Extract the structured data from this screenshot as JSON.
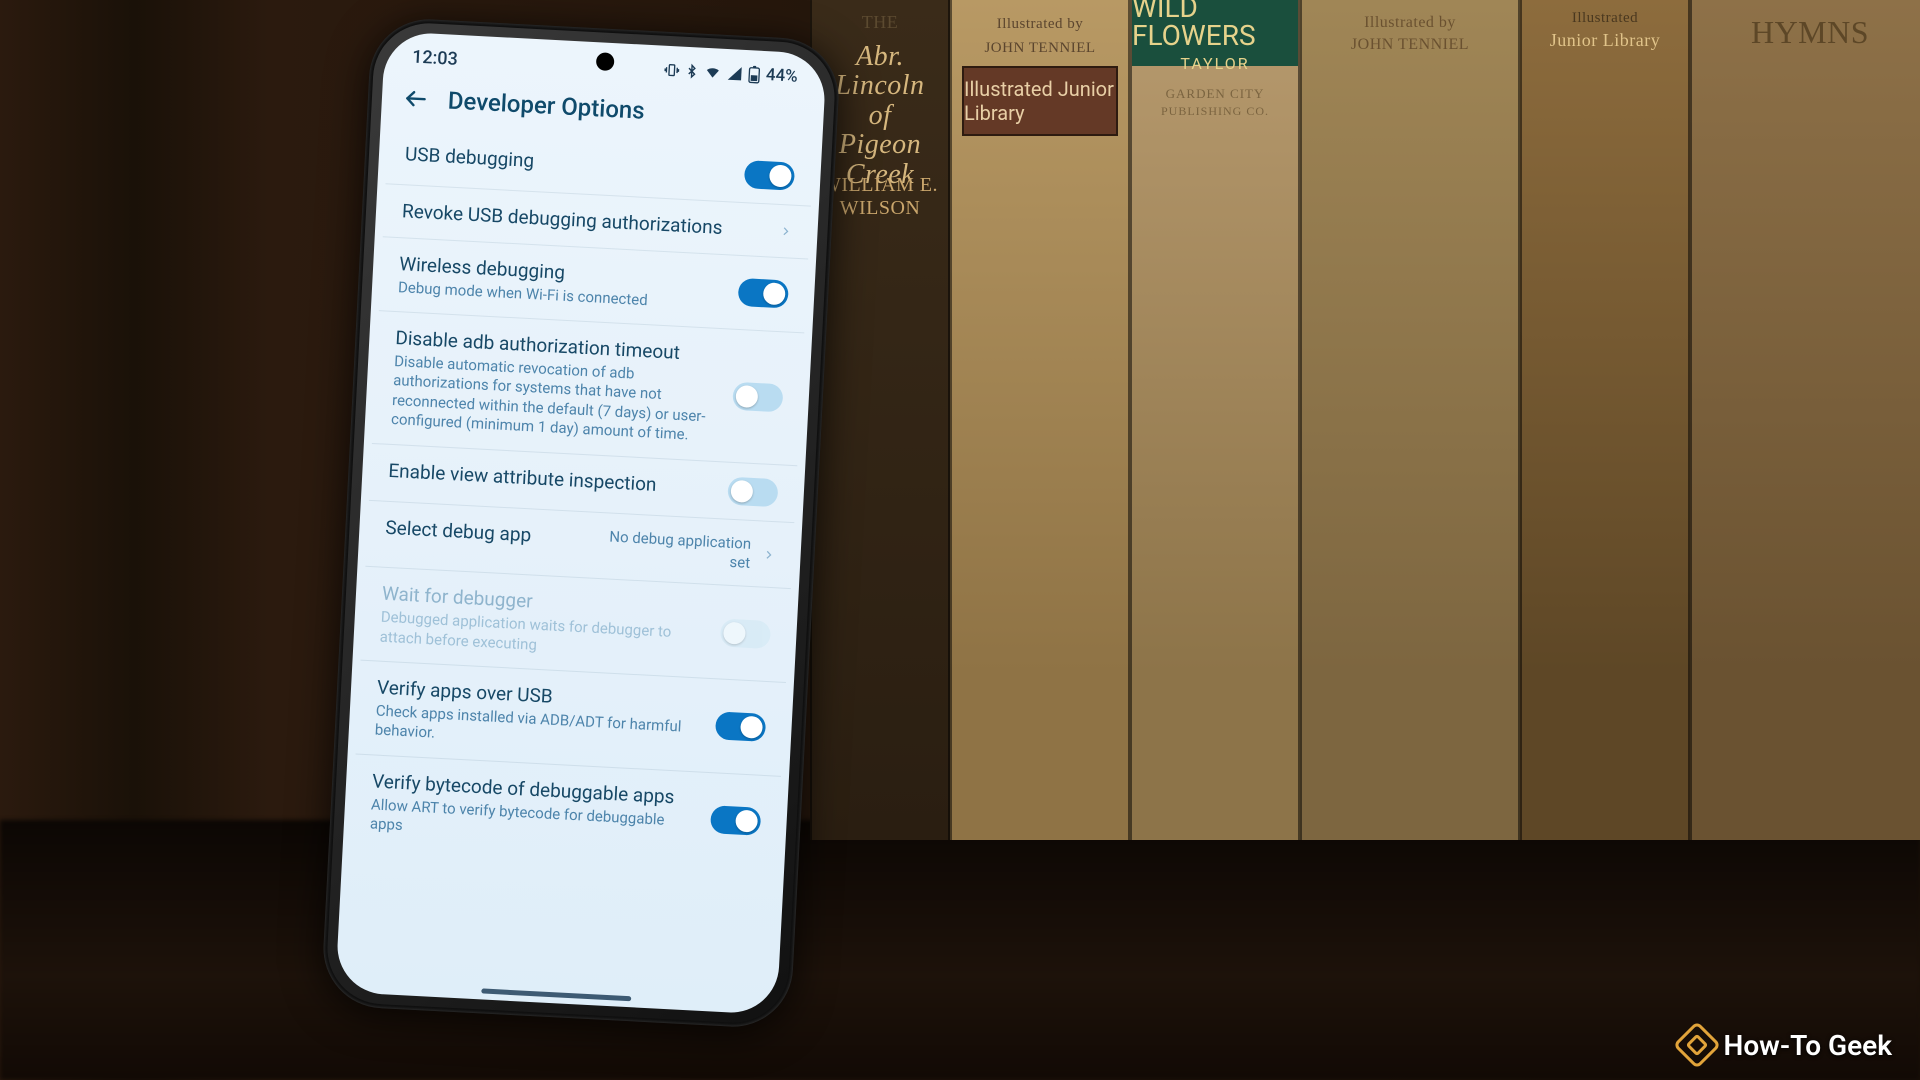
{
  "status": {
    "time": "12:03",
    "battery_pct": "44%"
  },
  "appbar": {
    "title": "Developer Options"
  },
  "rows": {
    "usb_debugging": {
      "title": "USB debugging"
    },
    "revoke": {
      "title": "Revoke USB debugging authorizations"
    },
    "wireless": {
      "title": "Wireless debugging",
      "subtitle": "Debug mode when Wi-Fi is connected"
    },
    "adb_timeout": {
      "title": "Disable adb authorization timeout",
      "subtitle": "Disable automatic revocation of adb authorizations for systems that have not reconnected within the default (7 days) or user-configured (minimum 1 day) amount of time."
    },
    "view_attr": {
      "title": "Enable view attribute inspection"
    },
    "select_debug": {
      "title": "Select debug app",
      "value": "No debug application set"
    },
    "wait_debugger": {
      "title": "Wait for debugger",
      "subtitle": "Debugged application waits for debugger to attach before executing"
    },
    "verify_usb": {
      "title": "Verify apps over USB",
      "subtitle": "Check apps installed via ADB/ADT for harmful behavior."
    },
    "verify_bytecode": {
      "title": "Verify bytecode of debuggable apps",
      "subtitle": "Allow ART to verify bytecode for debuggable apps"
    }
  },
  "bg_books": {
    "b1": {
      "line1": "THE",
      "line2": "Abr. Lincoln\nof\nPigeon Creek",
      "author": "WILLIAM E. WILSON"
    },
    "b2": {
      "line1": "Illustrated by",
      "line2": "JOHN TENNIEL",
      "panel": "Illustrated Junior Library"
    },
    "b3": {
      "title": "WILD FLOWERS",
      "author": "TAYLOR",
      "pub1": "GARDEN CITY",
      "pub2": "PUBLISHING CO."
    },
    "b4": {
      "line1": "Illustrated by",
      "line2": "JOHN TENNIEL"
    },
    "b5": {
      "line1": "Illustrated",
      "line2": "Junior Library"
    },
    "b6": {
      "title": "HYMNS"
    }
  },
  "watermark": "How-To Geek"
}
